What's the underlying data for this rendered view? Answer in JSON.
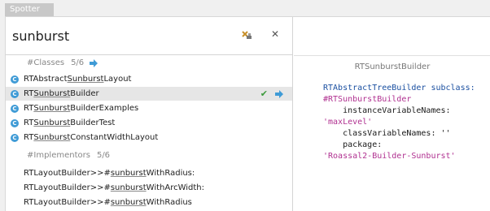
{
  "window_title": "Spotter",
  "search": {
    "value": "sunburst"
  },
  "classes_category": {
    "label": "#Classes",
    "count": "5/6"
  },
  "classes": [
    {
      "prefix": "RTAbstract",
      "match": "Sunburst",
      "suffix": "Layout"
    },
    {
      "prefix": "RT",
      "match": "Sunburst",
      "suffix": "Builder"
    },
    {
      "prefix": "RT",
      "match": "Sunburst",
      "suffix": "BuilderExamples"
    },
    {
      "prefix": "RT",
      "match": "Sunburst",
      "suffix": "BuilderTest"
    },
    {
      "prefix": "RT",
      "match": "Sunburst",
      "suffix": "ConstantWidthLayout"
    }
  ],
  "implementors_category": {
    "label": "#Implementors",
    "count": "5/6"
  },
  "implementors": [
    {
      "prefix": "RTLayoutBuilder>>#",
      "match": "sunburst",
      "suffix": "WithRadius:"
    },
    {
      "prefix": "RTLayoutBuilder>>#",
      "match": "sunburst",
      "suffix": "WithArcWidth:"
    },
    {
      "prefix": "RTLayoutBuilder>>#",
      "match": "sunburst",
      "suffix": "WithRadius"
    }
  ],
  "preview": {
    "title": "RTSunburstBuilder",
    "code": {
      "line1": "RTAbstractTreeBuilder subclass:",
      "line2": "#RTSunburstBuilder",
      "line3": "    instanceVariableNames:",
      "line4": "'maxLevel'",
      "line5": "    classVariableNames: ''",
      "line6": "    package:",
      "line7": "'Roassal2-Builder-Sunburst'"
    }
  },
  "colors": {
    "check": "#3c9a3c",
    "arrow": "#3f9bd6",
    "class_icon": "#3f9bd6"
  }
}
